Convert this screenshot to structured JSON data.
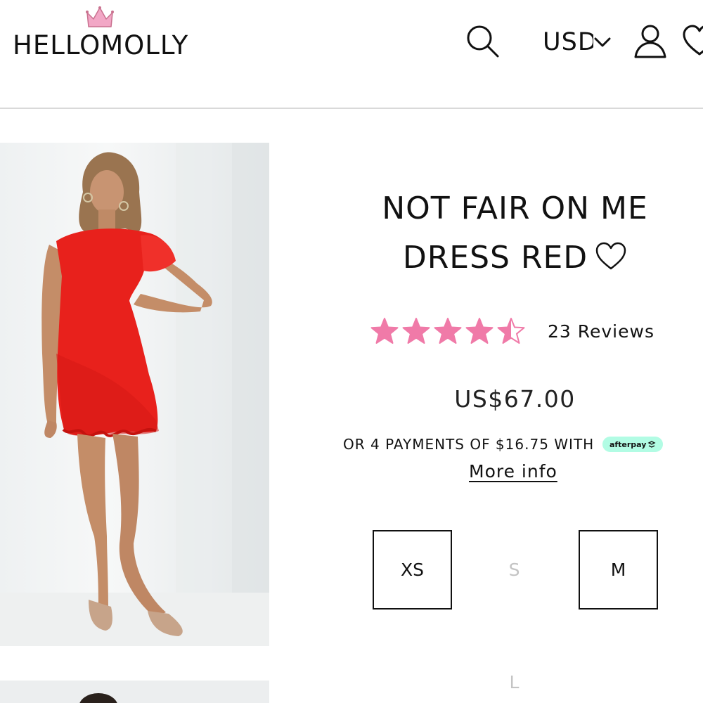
{
  "header": {
    "logo_text": "HELLOMOLLY",
    "currency": "USD",
    "icons": {
      "search": "search-icon",
      "currency_toggle": "chevron-down-icon",
      "account": "user-icon",
      "wishlist": "heart-icon"
    }
  },
  "product": {
    "title_line1": "NOT FAIR ON ME",
    "title_line2": "DRESS RED",
    "rating": 4.5,
    "rating_max": 5,
    "reviews_label": "23 Reviews",
    "price": "US$67.00",
    "installments_text": "OR 4 PAYMENTS OF $16.75 WITH",
    "afterpay_label": "afterpay",
    "more_info_label": "More info",
    "sizes": [
      {
        "label": "XS",
        "available": true
      },
      {
        "label": "S",
        "available": false
      },
      {
        "label": "M",
        "available": true
      },
      {
        "label": "L",
        "available": false
      }
    ]
  },
  "colors": {
    "star": "#f07aa8",
    "dress": "#e8211c",
    "afterpay": "#b2fce4",
    "crown": "#f2a7c6",
    "disabled": "#c4c4c4"
  }
}
